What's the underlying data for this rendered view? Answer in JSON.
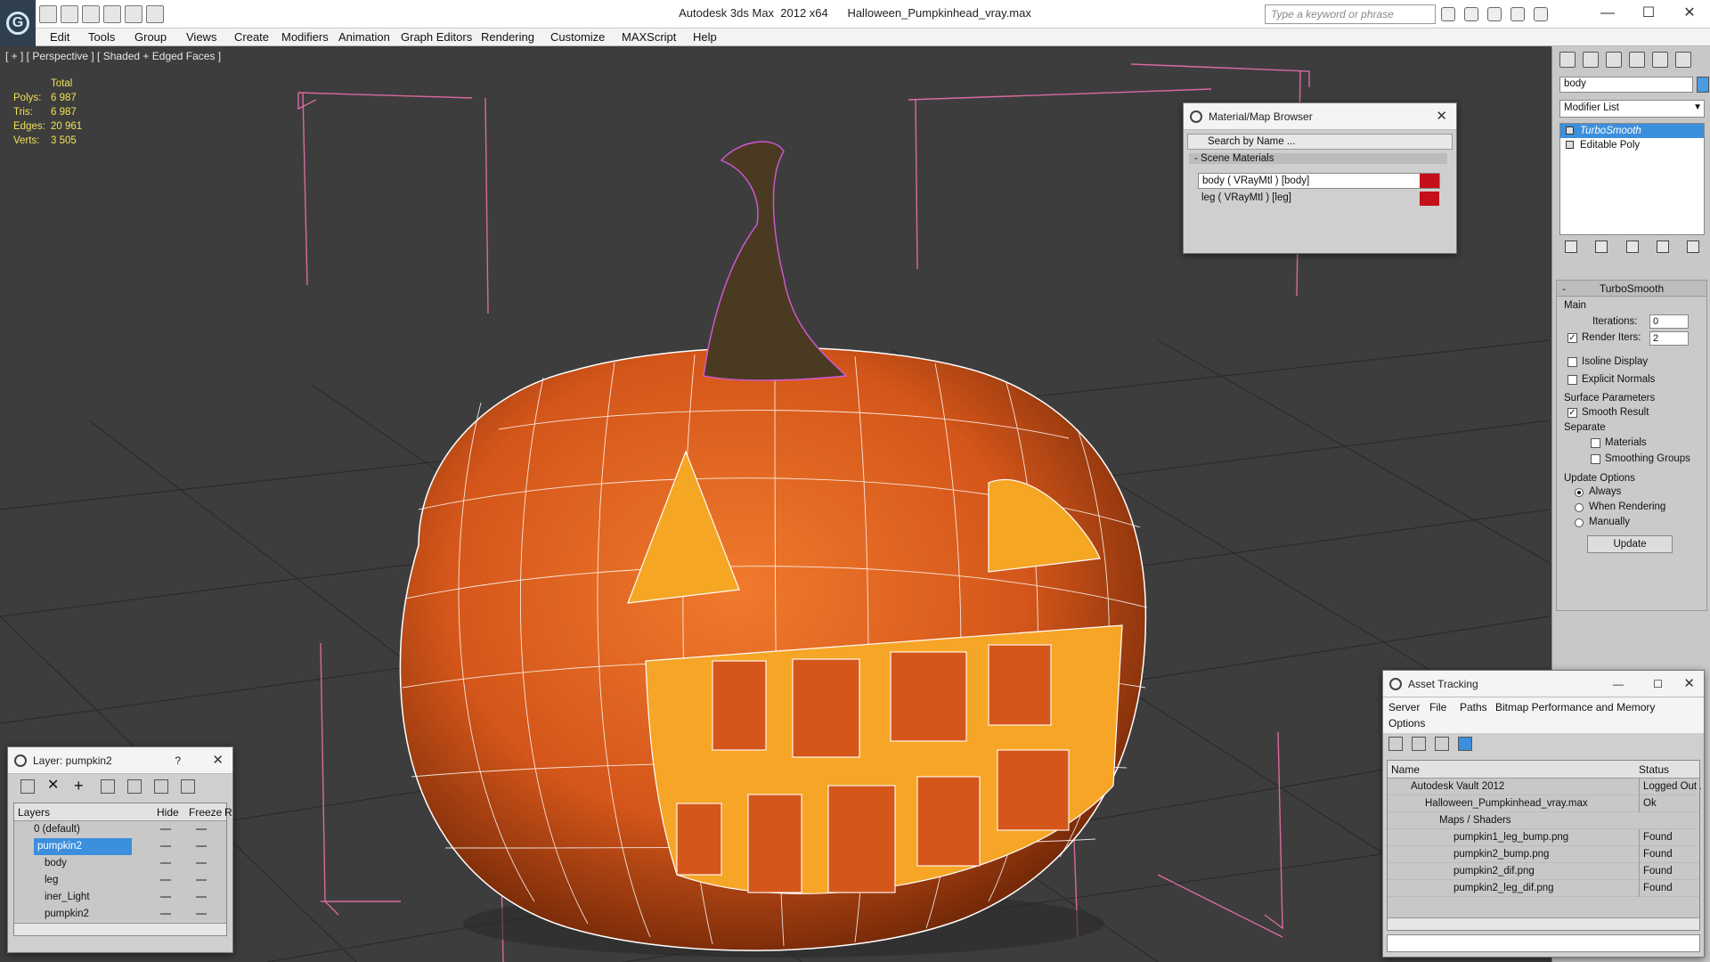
{
  "window": {
    "title": "Autodesk 3ds Max  2012 x64      Halloween_Pumpkinhead_vray.max",
    "search_placeholder": "Type a keyword or phrase",
    "min": "—",
    "max": "☐",
    "close": "✕"
  },
  "menu": [
    "Edit",
    "Tools",
    "Group",
    "Views",
    "Create",
    "Modifiers",
    "Animation",
    "Graph Editors",
    "Rendering",
    "Customize",
    "MAXScript",
    "Help"
  ],
  "viewport": {
    "label": "[ + ] [ Perspective ] [ Shaded + Edged Faces ]",
    "stats": {
      "header": "Total",
      "rows": [
        {
          "k": "Polys:",
          "v": "6 987"
        },
        {
          "k": "Tris:",
          "v": "6 987"
        },
        {
          "k": "Edges:",
          "v": "20 961"
        },
        {
          "k": "Verts:",
          "v": "3 505"
        }
      ]
    }
  },
  "material_browser": {
    "title": "Material/Map Browser",
    "search": "Search by Name ...",
    "section": "- Scene Materials",
    "items": [
      "body  ( VRayMtl ) [body]",
      "leg  ( VRayMtl ) [leg]"
    ]
  },
  "command_panel": {
    "object_name": "body",
    "modifier_list": "Modifier List",
    "stack": [
      "TurboSmooth",
      "Editable Poly"
    ],
    "turbosmooth": {
      "title": "TurboSmooth",
      "main": "Main",
      "iterations_label": "Iterations:",
      "iterations": "0",
      "render_iters_label": "Render Iters:",
      "render_iters": "2",
      "isoline": "Isoline Display",
      "explicit": "Explicit Normals",
      "surface": "Surface Parameters",
      "smooth_result": "Smooth Result",
      "separate": "Separate",
      "materials": "Materials",
      "smoothing_groups": "Smoothing Groups",
      "update_options": "Update Options",
      "always": "Always",
      "when_rendering": "When Rendering",
      "manually": "Manually",
      "update": "Update"
    }
  },
  "layer_panel": {
    "title": "Layer: pumpkin2",
    "help": "?",
    "cols": [
      "Layers",
      "Hide",
      "Freeze",
      "R"
    ],
    "rows": [
      {
        "name": "0 (default)",
        "indent": 1,
        "sel": false
      },
      {
        "name": "pumpkin2",
        "indent": 1,
        "sel": true
      },
      {
        "name": "body",
        "indent": 2,
        "sel": false
      },
      {
        "name": "leg",
        "indent": 2,
        "sel": false
      },
      {
        "name": "iner_Light",
        "indent": 2,
        "sel": false
      },
      {
        "name": "pumpkin2",
        "indent": 2,
        "sel": false
      }
    ]
  },
  "asset_tracking": {
    "title": "Asset Tracking",
    "menu": [
      "Server",
      "File",
      "Paths",
      "Bitmap Performance and Memory",
      "Options"
    ],
    "cols": [
      "Name",
      "Status"
    ],
    "rows": [
      {
        "name": "Autodesk Vault 2012",
        "status": "Logged Out ...",
        "indent": 0
      },
      {
        "name": "Halloween_Pumpkinhead_vray.max",
        "status": "Ok",
        "indent": 1
      },
      {
        "name": "Maps / Shaders",
        "status": "",
        "indent": 2
      },
      {
        "name": "pumpkin1_leg_bump.png",
        "status": "Found",
        "indent": 3
      },
      {
        "name": "pumpkin2_bump.png",
        "status": "Found",
        "indent": 3
      },
      {
        "name": "pumpkin2_dif.png",
        "status": "Found",
        "indent": 3
      },
      {
        "name": "pumpkin2_leg_dif.png",
        "status": "Found",
        "indent": 3
      }
    ]
  },
  "colors": {
    "pumpkin": "#d9581a",
    "wire": "#ffffff",
    "selection_box": "#e0609a",
    "highlight": "#3c8fdc"
  }
}
